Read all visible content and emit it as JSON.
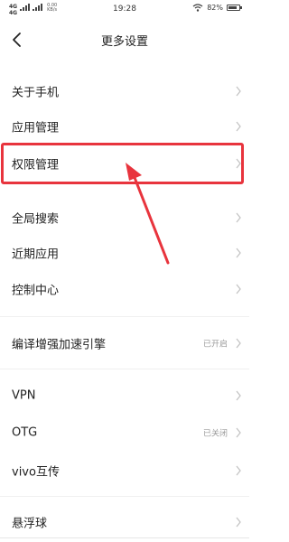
{
  "status_bar": {
    "network_label": "4G",
    "network_label2": "4G",
    "speed_top": "0.00",
    "speed_bottom": "KB/s",
    "time": "19:28",
    "battery_text": "82%",
    "battery_level_percent": 82
  },
  "header": {
    "back_icon": "chevron-left-icon",
    "title": "更多设置"
  },
  "settings_list": {
    "items": [
      {
        "label": "关于手机",
        "value": ""
      },
      {
        "label": "应用管理",
        "value": ""
      },
      {
        "label": "权限管理",
        "value": ""
      },
      {
        "label": "全局搜索",
        "value": ""
      },
      {
        "label": "近期应用",
        "value": ""
      },
      {
        "label": "控制中心",
        "value": ""
      },
      {
        "label": "编译增强加速引擎",
        "value": "已开启"
      },
      {
        "label": "VPN",
        "value": ""
      },
      {
        "label": "OTG",
        "value": "已关闭"
      },
      {
        "label": "vivo互传",
        "value": ""
      },
      {
        "label": "悬浮球",
        "value": ""
      }
    ]
  },
  "annotation": {
    "highlight_color": "#e8343d",
    "arrow_color": "#e8343d",
    "highlighted_item": "权限管理"
  }
}
